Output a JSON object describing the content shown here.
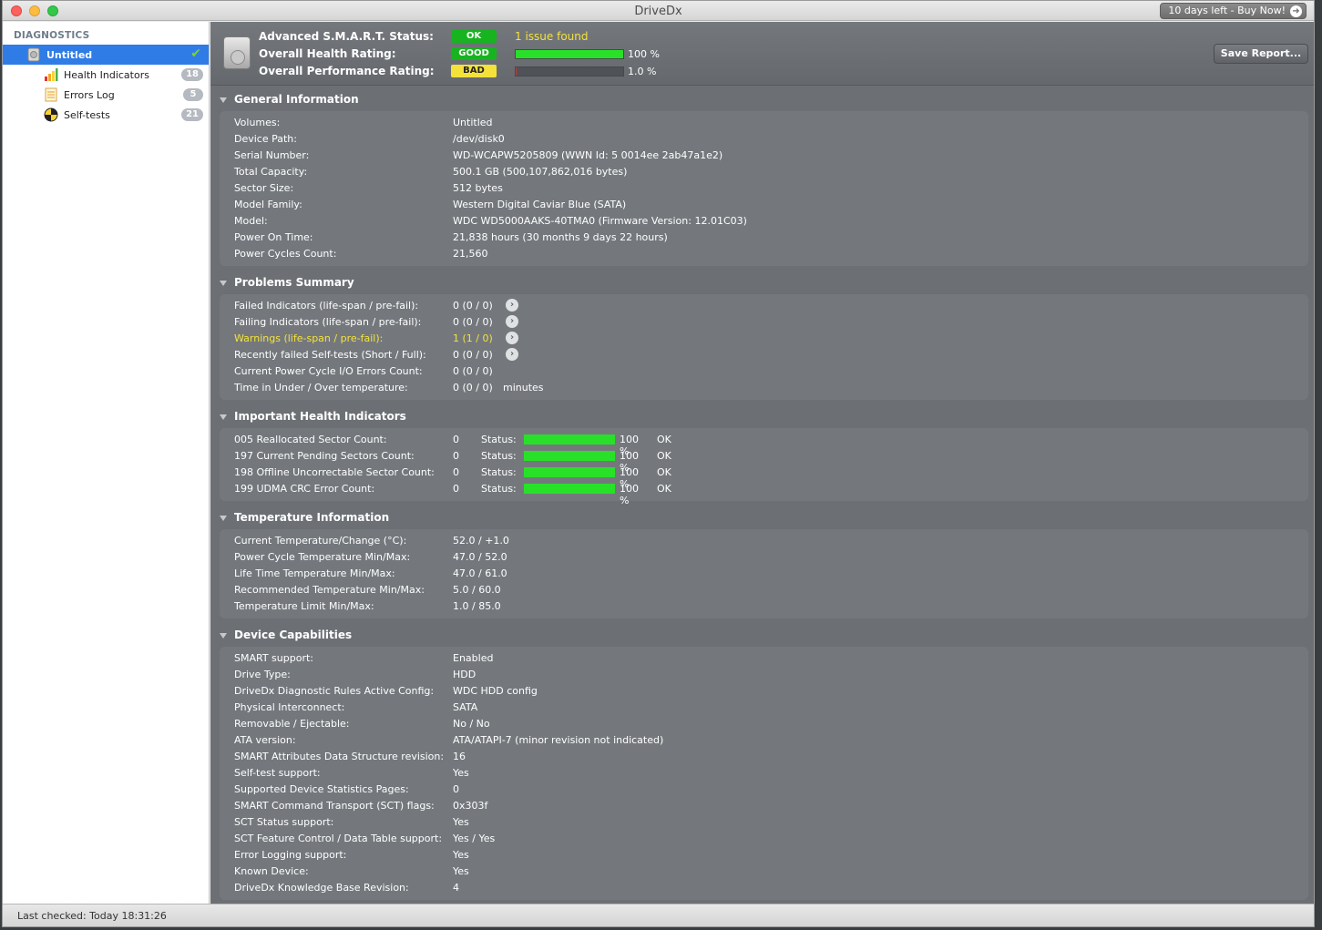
{
  "app": {
    "title": "DriveDx",
    "buy_label": "10 days left - Buy Now!"
  },
  "sidebar": {
    "header": "DIAGNOSTICS",
    "drive": "Untitled",
    "items": [
      {
        "label": "Health Indicators",
        "count": "18"
      },
      {
        "label": "Errors Log",
        "count": "5"
      },
      {
        "label": "Self-tests",
        "count": "21"
      }
    ]
  },
  "status_bar": {
    "last_checked": "Last checked: Today 18:31:26"
  },
  "header": {
    "smart_label": "Advanced S.M.A.R.T. Status:",
    "smart_value": "OK",
    "smart_note": "1 issue found",
    "health_label": "Overall Health Rating:",
    "health_value": "GOOD",
    "health_pct": "100 %",
    "health_fraction": 1.0,
    "perf_label": "Overall Performance Rating:",
    "perf_value": "BAD",
    "perf_pct": "1.0 %",
    "perf_fraction": 0.01,
    "save_label": "Save Report..."
  },
  "colors": {
    "ok_green": "#17b41f",
    "bar_green": "#29e029",
    "warn_yellow": "#f4e23a",
    "selection_blue": "#2f7ce6"
  },
  "general": {
    "title": "General Information",
    "rows": [
      {
        "k": "Volumes:",
        "v": "Untitled"
      },
      {
        "k": "Device Path:",
        "v": "/dev/disk0"
      },
      {
        "k": "Serial Number:",
        "v": "WD-WCAPW5205809 (WWN Id: 5 0014ee 2ab47a1e2)"
      },
      {
        "k": "Total Capacity:",
        "v": "500.1 GB (500,107,862,016 bytes)"
      },
      {
        "k": "Sector Size:",
        "v": "512 bytes"
      },
      {
        "k": "Model Family:",
        "v": "Western Digital Caviar Blue (SATA)"
      },
      {
        "k": "Model:",
        "v": "WDC WD5000AAKS-40TMA0  (Firmware Version: 12.01C03)"
      },
      {
        "k": "Power On Time:",
        "v": "21,838 hours (30 months 9 days 22 hours)"
      },
      {
        "k": "Power Cycles Count:",
        "v": "21,560"
      }
    ]
  },
  "problems": {
    "title": "Problems Summary",
    "rows": [
      {
        "k": "Failed Indicators (life-span / pre-fail):",
        "v": "0  (0 / 0)"
      },
      {
        "k": "Failing Indicators (life-span / pre-fail):",
        "v": "0  (0 / 0)"
      },
      {
        "k": "Warnings (life-span / pre-fail):",
        "v": "1  (1 / 0)"
      },
      {
        "k": "Recently failed Self-tests (Short / Full):",
        "v": "0  (0 / 0)"
      },
      {
        "k": "Current Power Cycle I/O Errors Count:",
        "v": "0  (0 / 0)"
      },
      {
        "k": "Time in Under / Over temperature:",
        "v": "0  (0 / 0)",
        "extra": "minutes"
      }
    ]
  },
  "health": {
    "title": "Important Health Indicators",
    "status_label": "Status:",
    "rows": [
      {
        "k": "005  Reallocated Sector Count:",
        "v": "0",
        "pct": "100 %",
        "fraction": 1.0,
        "state": "OK"
      },
      {
        "k": "197  Current Pending Sectors Count:",
        "v": "0",
        "pct": "100 %",
        "fraction": 1.0,
        "state": "OK"
      },
      {
        "k": "198  Offline Uncorrectable Sector Count:",
        "v": "0",
        "pct": "100 %",
        "fraction": 1.0,
        "state": "OK"
      },
      {
        "k": "199  UDMA CRC Error Count:",
        "v": "0",
        "pct": "100 %",
        "fraction": 1.0,
        "state": "OK"
      }
    ]
  },
  "temperature": {
    "title": "Temperature Information",
    "rows": [
      {
        "k": "Current Temperature/Change (°C):",
        "v": "52.0 / +1.0"
      },
      {
        "k": "Power Cycle Temperature Min/Max:",
        "v": "47.0 / 52.0"
      },
      {
        "k": "Life Time Temperature Min/Max:",
        "v": "47.0 / 61.0"
      },
      {
        "k": "Recommended Temperature Min/Max:",
        "v": "5.0   / 60.0"
      },
      {
        "k": "Temperature Limit Min/Max:",
        "v": "1.0   / 85.0"
      }
    ]
  },
  "capabilities": {
    "title": "Device Capabilities",
    "rows": [
      {
        "k": "SMART support:",
        "v": "Enabled"
      },
      {
        "k": "Drive Type:",
        "v": "HDD"
      },
      {
        "k": "DriveDx Diagnostic Rules Active Config:",
        "v": "WDC HDD config"
      },
      {
        "k": "Physical Interconnect:",
        "v": "SATA"
      },
      {
        "k": "Removable / Ejectable:",
        "v": "No / No"
      },
      {
        "k": "ATA version:",
        "v": "ATA/ATAPI-7 (minor revision not indicated)"
      },
      {
        "k": "SMART Attributes Data Structure revision:",
        "v": "16"
      },
      {
        "k": "Self-test support:",
        "v": "Yes"
      },
      {
        "k": "Supported Device Statistics Pages:",
        "v": "0"
      },
      {
        "k": "SMART Command Transport (SCT) flags:",
        "v": "0x303f"
      },
      {
        "k": "SCT Status support:",
        "v": "Yes"
      },
      {
        "k": "SCT Feature Control / Data Table support:",
        "v": "Yes / Yes"
      },
      {
        "k": "Error Logging support:",
        "v": "Yes"
      },
      {
        "k": "Known Device:",
        "v": "Yes"
      },
      {
        "k": "DriveDx Knowledge Base Revision:",
        "v": "4"
      }
    ]
  }
}
